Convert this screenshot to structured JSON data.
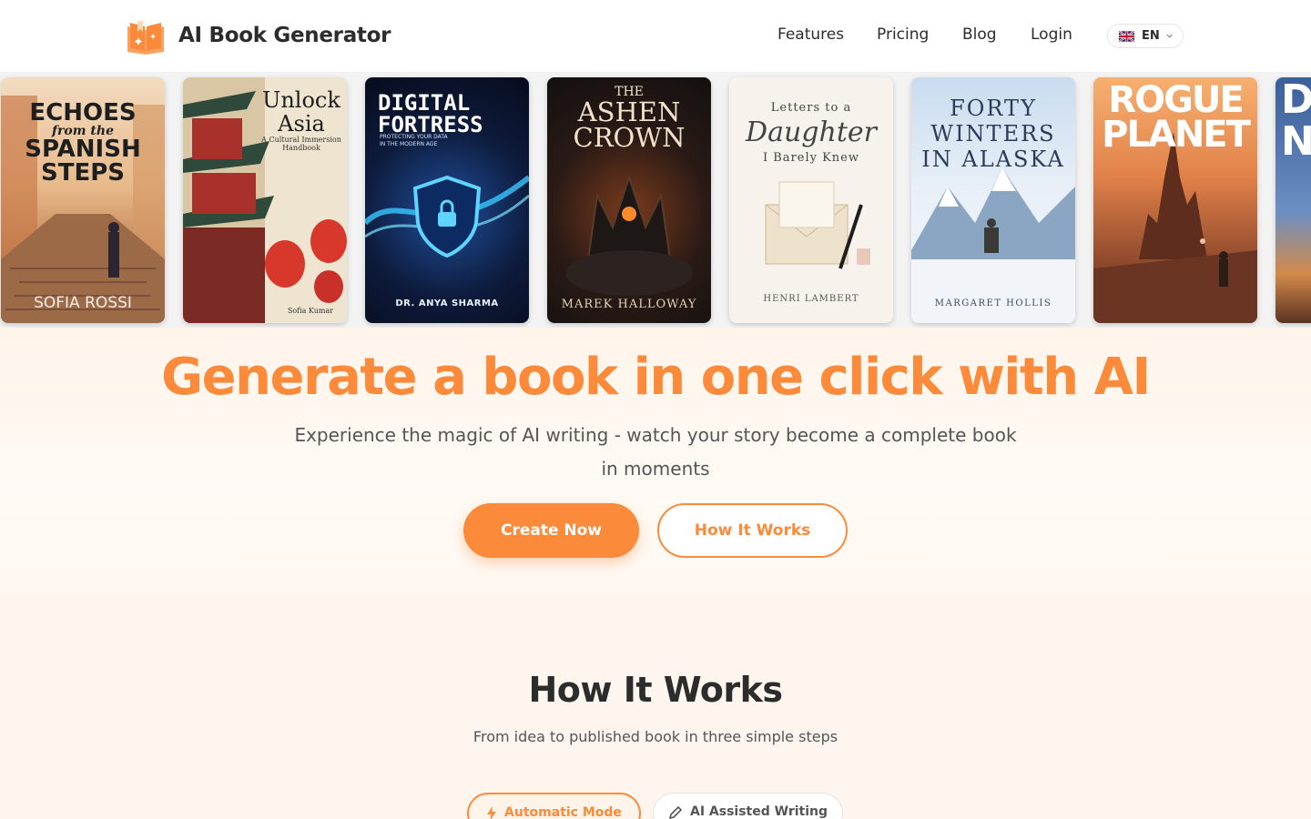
{
  "header": {
    "brand": "AI Book Generator",
    "nav": [
      "Features",
      "Pricing",
      "Blog",
      "Login"
    ],
    "language": "EN"
  },
  "books": [
    {
      "title_lines": [
        "ECHOES",
        "from the",
        "SPANISH",
        "STEPS"
      ],
      "author": "SOFIA ROSSI"
    },
    {
      "title_lines": [
        "Unlock",
        "Asia"
      ],
      "subtitle": "A Cultural Immersion Handbook",
      "author": "Sofia Kumar"
    },
    {
      "title_lines": [
        "DIGITAL",
        "FORTRESS"
      ],
      "subtitle": "PROTECTING YOUR DATA IN THE MODERN AGE",
      "author": "DR. ANYA SHARMA"
    },
    {
      "title_lines": [
        "THE",
        "ASHEN",
        "CROWN"
      ],
      "author": "MAREK HALLOWAY"
    },
    {
      "title_lines": [
        "Letters to a",
        "Daughter",
        "I Barely Knew"
      ],
      "author": "HENRI LAMBERT"
    },
    {
      "title_lines": [
        "FORTY",
        "WINTERS",
        "IN ALASKA"
      ],
      "author": "MARGARET HOLLIS"
    },
    {
      "title_lines": [
        "ROGUE",
        "PLANET"
      ],
      "author": ""
    },
    {
      "title_lines": [
        "D",
        "N"
      ],
      "author": ""
    }
  ],
  "hero": {
    "headline": "Generate a book in one click with AI",
    "subtext": "Experience the magic of AI writing - watch your story become a complete book in moments",
    "primary_cta": "Create Now",
    "secondary_cta": "How It Works"
  },
  "how": {
    "title": "How It Works",
    "subtitle": "From idea to published book in three simple steps",
    "tabs": [
      "Automatic Mode",
      "AI Assisted Writing"
    ]
  },
  "colors": {
    "accent": "#fb8a3a",
    "text": "#2c2c2c"
  }
}
